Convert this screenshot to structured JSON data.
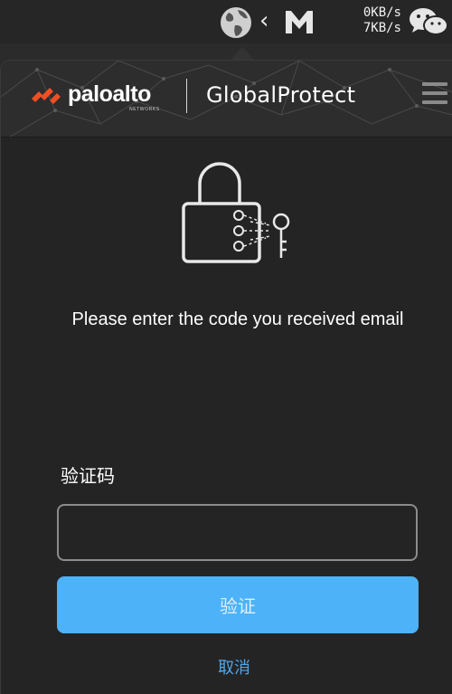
{
  "menubar": {
    "network_speed": {
      "upload": "0KB/s",
      "download": "7KB/s"
    },
    "icons": [
      "globe-icon",
      "chevron-left-icon",
      "gmail-m-icon",
      "wechat-icon"
    ]
  },
  "header": {
    "brand": "paloalto",
    "brand_sub": "NETWORKS",
    "app_title": "GlobalProtect",
    "menu_icon": "hamburger-menu-icon"
  },
  "main": {
    "illustration_icon": "lock-with-key-icon",
    "message": "Please enter the code you received email",
    "field_label": "验证码",
    "code_input": {
      "value": "",
      "placeholder": ""
    },
    "verify_label": "验证",
    "cancel_label": "取消"
  },
  "colors": {
    "accent": "#4db2f7",
    "link": "#4fa8ec",
    "brand_orange": "#f04e23",
    "panel_bg": "#242424"
  }
}
